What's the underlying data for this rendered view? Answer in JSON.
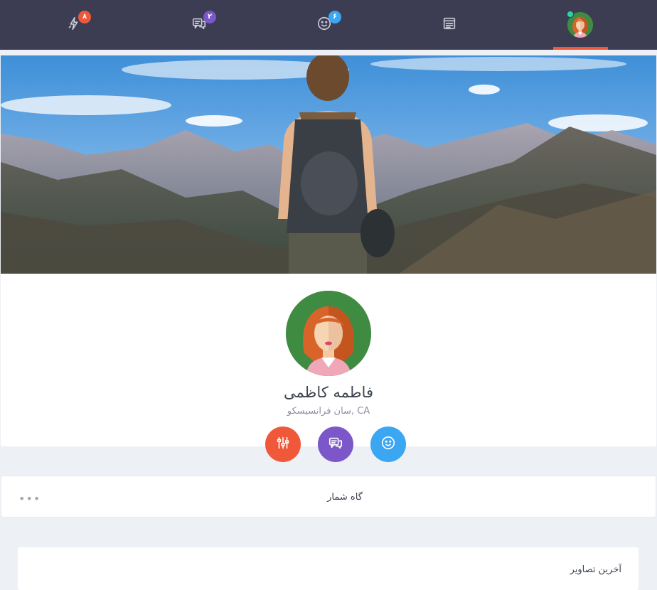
{
  "topnav": {
    "items": [
      {
        "name": "lightning-icon",
        "badge": "۸",
        "badge_color": "#f0583a"
      },
      {
        "name": "chat-icon",
        "badge": "۲",
        "badge_color": "#7b57c9"
      },
      {
        "name": "smiley-icon",
        "badge": "۶",
        "badge_color": "#3ba6f2"
      },
      {
        "name": "list-icon",
        "badge": ""
      },
      {
        "name": "avatar",
        "badge": ""
      }
    ],
    "active_color": "#f0583a",
    "background": "#3c3d52"
  },
  "profile": {
    "name": "فاطمه کاظمی",
    "location": "سان فرانسیسکو, CA"
  },
  "actions": [
    {
      "name": "settings-sliders-icon",
      "color": "#f0583a"
    },
    {
      "name": "chat-icon",
      "color": "#7b57c9"
    },
    {
      "name": "smiley-icon",
      "color": "#3ba6f2"
    }
  ],
  "counter": {
    "title": "گاه شمار",
    "more": "•••"
  },
  "photos": {
    "title": "آخرین تصاویر"
  }
}
